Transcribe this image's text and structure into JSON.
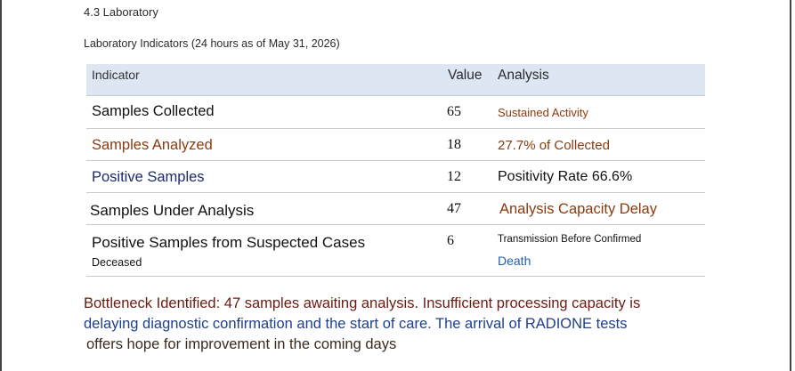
{
  "section": {
    "heading": "4.3 Laboratory"
  },
  "table": {
    "caption": "Laboratory Indicators (24 hours as of May 31, 2026)",
    "headers": {
      "indicator": "Indicator",
      "value": "Value",
      "analysis": "Analysis"
    },
    "rows": [
      {
        "indicator": "Samples Collected",
        "value": "65",
        "analysis": "Sustained Activity"
      },
      {
        "indicator": "Samples Analyzed",
        "value": "18",
        "analysis": "27.7% of Collected"
      },
      {
        "indicator": "Positive Samples",
        "value": "12",
        "analysis": "Positivity Rate 66.6%"
      },
      {
        "indicator": "Samples Under Analysis",
        "value": "47",
        "analysis": "Analysis Capacity Delay"
      },
      {
        "indicator": "Positive Samples from Suspected Cases",
        "indicator_sub": "Deceased",
        "value": "6",
        "analysis": "Transmission Before Confirmed",
        "analysis_sub": "Death"
      }
    ]
  },
  "bottleneck": {
    "line1": "Bottleneck Identified: 47 samples awaiting analysis. Insufficient processing capacity is",
    "line2": "delaying diagnostic confirmation and the start of care. The arrival of RADIONE tests",
    "line3": "offers hope for improvement in the coming days"
  },
  "colors": {
    "header_bg": "#dce7f3",
    "brown": "#8b3a10",
    "navy": "#1e2a6e",
    "blue": "#1f5fb4"
  }
}
